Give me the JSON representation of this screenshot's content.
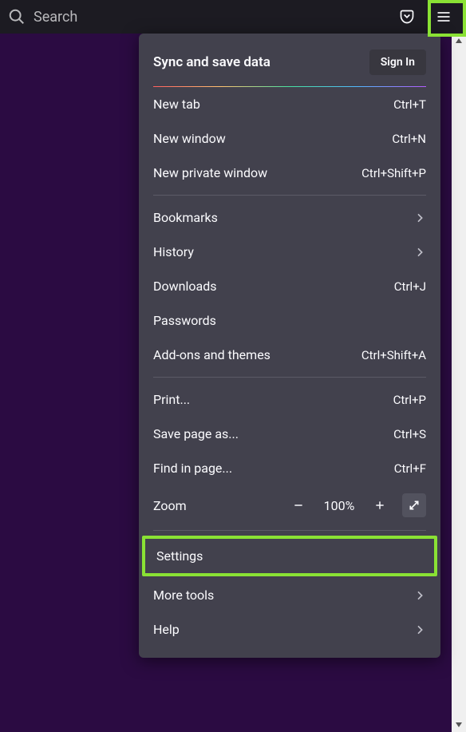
{
  "toolbar": {
    "search_placeholder": "Search"
  },
  "menu": {
    "sync_title": "Sync and save data",
    "sign_in": "Sign In",
    "items": {
      "new_tab": {
        "label": "New tab",
        "shortcut": "Ctrl+T"
      },
      "new_window": {
        "label": "New window",
        "shortcut": "Ctrl+N"
      },
      "new_private": {
        "label": "New private window",
        "shortcut": "Ctrl+Shift+P"
      },
      "bookmarks": {
        "label": "Bookmarks"
      },
      "history": {
        "label": "History"
      },
      "downloads": {
        "label": "Downloads",
        "shortcut": "Ctrl+J"
      },
      "passwords": {
        "label": "Passwords"
      },
      "addons": {
        "label": "Add-ons and themes",
        "shortcut": "Ctrl+Shift+A"
      },
      "print": {
        "label": "Print...",
        "shortcut": "Ctrl+P"
      },
      "save_page": {
        "label": "Save page as...",
        "shortcut": "Ctrl+S"
      },
      "find": {
        "label": "Find in page...",
        "shortcut": "Ctrl+F"
      },
      "zoom": {
        "label": "Zoom",
        "level": "100%"
      },
      "settings": {
        "label": "Settings"
      },
      "more_tools": {
        "label": "More tools"
      },
      "help": {
        "label": "Help"
      }
    }
  }
}
